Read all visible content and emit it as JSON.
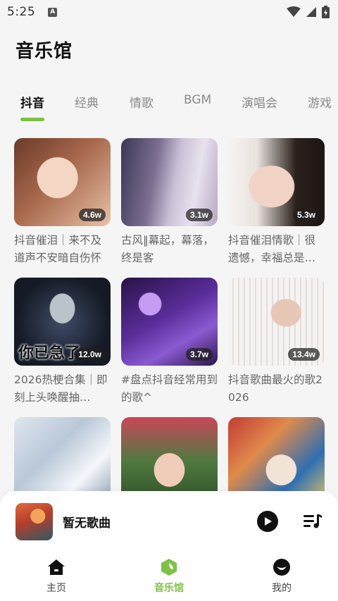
{
  "status": {
    "time": "5:25",
    "notif_glyph": "A"
  },
  "page": {
    "title": "音乐馆"
  },
  "tabs": [
    {
      "label": "抖音",
      "active": true
    },
    {
      "label": "经典"
    },
    {
      "label": "情歌"
    },
    {
      "label": "BGM"
    },
    {
      "label": "演唱会"
    },
    {
      "label": "游戏"
    }
  ],
  "playlists": [
    {
      "title": "抖音催泪｜来不及道声不安暗自伤怀",
      "count": "4.6w"
    },
    {
      "title": "古风‖幕起，幕落，终是客",
      "count": "3.1w"
    },
    {
      "title": "抖音催泪情歌｜很遗憾，幸福总是…",
      "count": "5.3w"
    },
    {
      "title": "2026热梗合集｜即刻上头唤醒抽…",
      "count": "12.0w",
      "cover_text": "你已急了"
    },
    {
      "title": "#盘点抖音经常用到的歌^",
      "count": "3.7w"
    },
    {
      "title": "抖音歌曲最火的歌2026",
      "count": "13.4w"
    },
    {
      "title": "",
      "count": ""
    },
    {
      "title": "",
      "count": ""
    },
    {
      "title": "",
      "count": ""
    }
  ],
  "player": {
    "title": "暂无歌曲"
  },
  "nav": [
    {
      "label": "主页",
      "icon": "home-icon"
    },
    {
      "label": "音乐馆",
      "icon": "music-hall-icon",
      "active": true
    },
    {
      "label": "我的",
      "icon": "profile-icon"
    }
  ],
  "colors": {
    "accent": "#7cc243",
    "background": "#f5f5f5"
  }
}
